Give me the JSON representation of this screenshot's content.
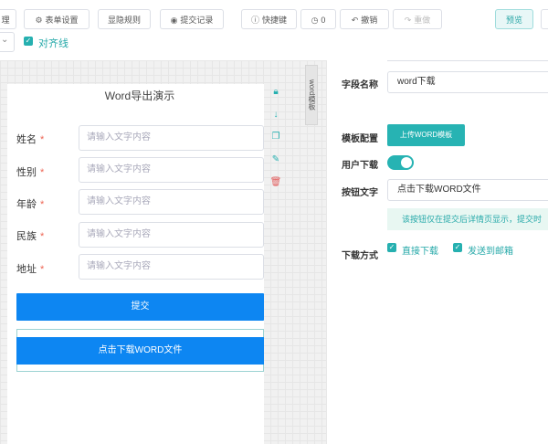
{
  "toolbar": {
    "buttons": [
      {
        "label": "理",
        "icon": ""
      },
      {
        "label": "表单设置",
        "icon": "⚙"
      },
      {
        "label": "显隐规则",
        "icon": ""
      },
      {
        "label": "提交记录",
        "icon": "◉"
      },
      {
        "label": "快捷键",
        "icon": "ⓘ"
      },
      {
        "label": "0",
        "icon": "◷"
      },
      {
        "label": "撤销",
        "icon": "↶"
      },
      {
        "label": "重做",
        "icon": "↷"
      },
      {
        "label": "预览",
        "icon": ""
      }
    ],
    "align_label": "对齐线"
  },
  "form": {
    "title": "Word导出演示",
    "fields": [
      {
        "label": "姓名",
        "required": "*",
        "placeholder": "请输入文字内容"
      },
      {
        "label": "性别",
        "required": "*",
        "placeholder": "请输入文字内容"
      },
      {
        "label": "年龄",
        "required": "*",
        "placeholder": "请输入文字内容"
      },
      {
        "label": "民族",
        "required": "*",
        "placeholder": "请输入文字内容"
      },
      {
        "label": "地址",
        "required": "*",
        "placeholder": "请输入文字内容"
      }
    ],
    "submit_label": "提交",
    "download_label": "点击下载WORD文件"
  },
  "side_tab": "word模板",
  "panel": {
    "field_name_label": "字段名称",
    "field_name_value": "word下载",
    "template_label": "模板配置",
    "upload_label": "上传WORD模板",
    "user_download_label": "用户下载",
    "button_text_label": "按钮文字",
    "button_text_value": "点击下载WORD文件",
    "tip": "该按钮仅在提交后详情页显示，提交时",
    "download_method_label": "下载方式",
    "option_direct": "直接下载",
    "option_email": "发送到邮箱"
  },
  "colors": {
    "teal": "#27b3b3",
    "blue": "#0d86f2",
    "required": "#e65555"
  }
}
